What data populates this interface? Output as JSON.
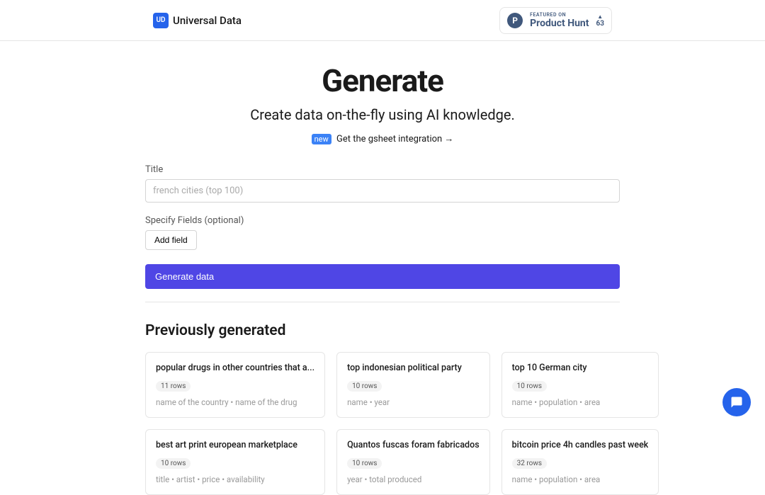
{
  "app_name": "Universal Data",
  "logo_abbr": "UD",
  "product_hunt": {
    "featured_label": "FEATURED ON",
    "name": "Product Hunt",
    "votes": "63"
  },
  "hero": {
    "title": "Generate",
    "subtitle": "Create data on-the-fly using AI knowledge.",
    "new_badge": "new",
    "gsheet_link": "Get the gsheet integration →"
  },
  "form": {
    "title_label": "Title",
    "title_placeholder": "french cities (top 100)",
    "fields_label": "Specify Fields (optional)",
    "add_field_label": "Add field",
    "generate_label": "Generate data"
  },
  "previously_generated": {
    "heading": "Previously generated",
    "items": [
      {
        "title": "popular drugs in other countries that a...",
        "rows": "11 rows",
        "fields": "name of the country • name of the drug"
      },
      {
        "title": "top indonesian political party",
        "rows": "10 rows",
        "fields": "name • year"
      },
      {
        "title": "top 10 German city",
        "rows": "10 rows",
        "fields": "name • population • area"
      },
      {
        "title": "best art print european marketplace",
        "rows": "10 rows",
        "fields": "title • artist • price • availability"
      },
      {
        "title": "Quantos fuscas foram fabricados",
        "rows": "10 rows",
        "fields": "year • total produced"
      },
      {
        "title": "bitcoin price 4h candles past week",
        "rows": "32 rows",
        "fields": "name • population • area"
      }
    ]
  }
}
